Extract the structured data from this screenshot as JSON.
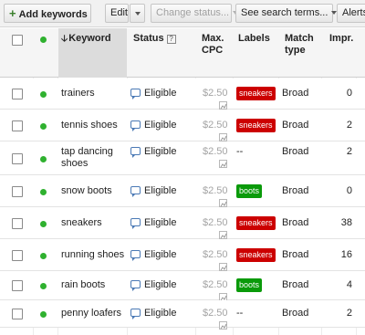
{
  "toolbar": {
    "add_keywords": "Add keywords",
    "edit": "Edit",
    "change_status": "Change status...",
    "see_search_terms": "See search terms...",
    "alerts": "Alerts"
  },
  "columns": {
    "keyword": "Keyword",
    "status": "Status",
    "max_cpc": "Max. CPC",
    "labels": "Labels",
    "match_type": "Match type",
    "impr": "Impr."
  },
  "colors": {
    "sneakers_label": "#cc0000",
    "boots_label": "#0a9a0a",
    "enabled_dot": "#2fb12f"
  },
  "rows": [
    {
      "keyword": "trainers",
      "status": "Eligible",
      "cpc": "$2.50",
      "label": "sneakers",
      "label_color": "#cc0000",
      "match": "Broad",
      "impr": "0"
    },
    {
      "keyword": "tennis shoes",
      "status": "Eligible",
      "cpc": "$2.50",
      "label": "sneakers",
      "label_color": "#cc0000",
      "match": "Broad",
      "impr": "2"
    },
    {
      "keyword": "tap dancing shoes",
      "status": "Eligible",
      "cpc": "$2.50",
      "label": "--",
      "label_color": "",
      "match": "Broad",
      "impr": "2"
    },
    {
      "keyword": "snow boots",
      "status": "Eligible",
      "cpc": "$2.50",
      "label": "boots",
      "label_color": "#0a9a0a",
      "match": "Broad",
      "impr": "0"
    },
    {
      "keyword": "sneakers",
      "status": "Eligible",
      "cpc": "$2.50",
      "label": "sneakers",
      "label_color": "#cc0000",
      "match": "Broad",
      "impr": "38"
    },
    {
      "keyword": "running shoes",
      "status": "Eligible",
      "cpc": "$2.50",
      "label": "sneakers",
      "label_color": "#cc0000",
      "match": "Broad",
      "impr": "16"
    },
    {
      "keyword": "rain boots",
      "status": "Eligible",
      "cpc": "$2.50",
      "label": "boots",
      "label_color": "#0a9a0a",
      "match": "Broad",
      "impr": "4"
    },
    {
      "keyword": "penny loafers",
      "status": "Eligible",
      "cpc": "$2.50",
      "label": "--",
      "label_color": "",
      "match": "Broad",
      "impr": "2"
    }
  ]
}
